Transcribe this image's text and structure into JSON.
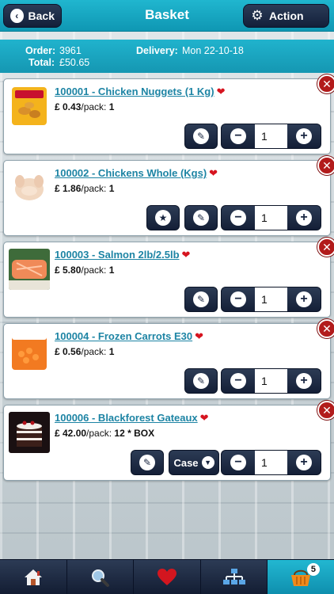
{
  "header": {
    "title": "Basket",
    "back_label": "Back",
    "action_label": "Action"
  },
  "order": {
    "order_label": "Order:",
    "order_value": "3961",
    "total_label": "Total:",
    "total_value": "£50.65",
    "delivery_label": "Delivery:",
    "delivery_value": "Mon 22-10-18"
  },
  "items": [
    {
      "title": "100001 - Chicken Nuggets (1 Kg)",
      "price": "£ 0.43",
      "pack_label": "/pack:",
      "pack": "1",
      "qty": "1",
      "thumb": "nuggets"
    },
    {
      "title": "100002 - Chickens Whole (Kgs)",
      "price": "£ 1.86",
      "pack_label": "/pack:",
      "pack": "1",
      "qty": "1",
      "thumb": "chicken"
    },
    {
      "title": "100003 - Salmon 2lb/2.5lb",
      "price": "£ 5.80",
      "pack_label": "/pack:",
      "pack": "1",
      "qty": "1",
      "thumb": "salmon"
    },
    {
      "title": "100004 - Frozen Carrots E30",
      "price": "£ 0.56",
      "pack_label": "/pack:",
      "pack": "1",
      "qty": "1",
      "thumb": "carrots"
    },
    {
      "title": "100006 - Blackforest Gateaux",
      "price": "£ 42.00",
      "pack_label": "/pack:",
      "pack": "12 * BOX",
      "qty": "1",
      "thumb": "gateaux",
      "unit_select": "Case"
    }
  ],
  "tabbar": {
    "tabs": [
      "home-icon",
      "search-icon",
      "heart-icon",
      "categories-icon",
      "basket-icon"
    ],
    "basket_count": "5"
  },
  "colors": {
    "accent": "#1597b2",
    "button_dark": "#1a2640",
    "link": "#1d84a4",
    "remove": "#b21b1b"
  }
}
